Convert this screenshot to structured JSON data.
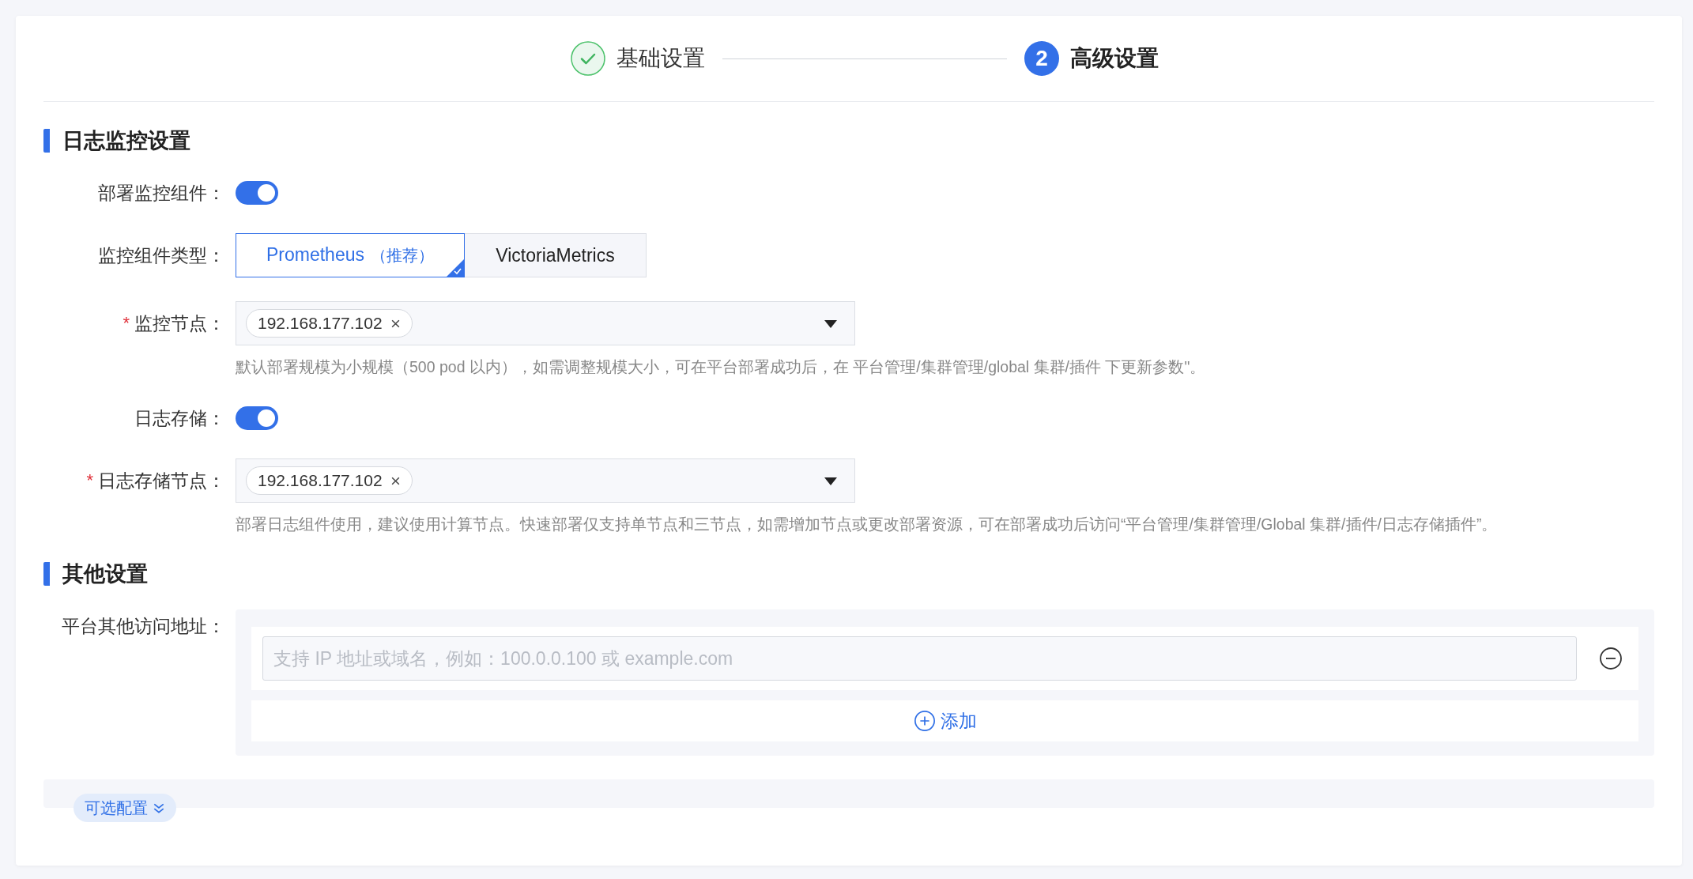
{
  "steps": [
    {
      "kind": "done",
      "label": "基础设置"
    },
    {
      "kind": "current",
      "number": "2",
      "label": "高级设置"
    }
  ],
  "sections": [
    {
      "title": "日志监控设置",
      "fields": [
        {
          "kind": "switch",
          "label": "部署监控组件：",
          "on": true
        },
        {
          "kind": "segmented",
          "label": "监控组件类型：",
          "options": [
            {
              "label": "Prometheus",
              "note": "（推荐）",
              "selected": true
            },
            {
              "label": "VictoriaMetrics",
              "selected": false
            }
          ]
        },
        {
          "kind": "select",
          "required_mark": "*",
          "label": "监控节点：",
          "tags": [
            "192.168.177.102"
          ],
          "hint": "默认部署规模为小规模（500 pod 以内），如需调整规模大小，可在平台部署成功后，在 平台管理/集群管理/global 集群/插件 下更新参数\"。"
        },
        {
          "kind": "switch",
          "label": "日志存储：",
          "on": true
        },
        {
          "kind": "select",
          "required_mark": "*",
          "label": "日志存储节点：",
          "tags": [
            "192.168.177.102"
          ],
          "hint": "部署日志组件使用，建议使用计算节点。快速部署仅支持单节点和三节点，如需增加节点或更改部署资源，可在部署成功后访问“平台管理/集群管理/Global 集群/插件/日志存储插件”。"
        }
      ]
    },
    {
      "title": "其他设置",
      "fields": [
        {
          "kind": "address-list",
          "label": "平台其他访问地址：",
          "rows": [
            {
              "placeholder": "支持 IP 地址或域名，例如：100.0.0.100 或 example.com"
            }
          ],
          "add_label": "添加"
        }
      ]
    }
  ],
  "optional": {
    "label": "可选配置",
    "expanded": false
  }
}
